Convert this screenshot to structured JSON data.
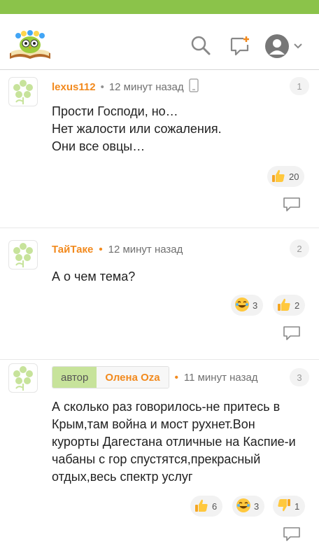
{
  "app": {
    "accent_color": "#8bc34a",
    "orange_color": "#f28a1e"
  },
  "header": {
    "logo_icon": "owl-book-logo-icon",
    "search_icon": "search-icon",
    "new_post_icon": "new-post-icon",
    "profile_icon": "user-avatar-icon"
  },
  "comments": [
    {
      "username": "lexus112",
      "time": "12 минут назад",
      "device_icon": "phone-icon",
      "number": "1",
      "lines": [
        "Прости Господи, но…",
        "Нет жалости или сожаления.",
        "Они все овцы…"
      ],
      "reactions": [
        {
          "icon": "thumbs-up-icon",
          "count": "20"
        }
      ]
    },
    {
      "username": "ТайТаке",
      "time": "12 минут назад",
      "number": "2",
      "lines": [
        "А о чем тема?"
      ],
      "reactions": [
        {
          "icon": "laugh-icon",
          "count": "3"
        },
        {
          "icon": "thumbs-up-icon",
          "count": "2"
        }
      ]
    },
    {
      "author_label": "автор",
      "username": "Олена Oza",
      "time": "11 минут назад",
      "number": "3",
      "lines": [
        "А сколько раз говорилось-не притесь в",
        "Крым,там война и мост рухнет.Вон",
        "курорты Дагестана отличные на Каспие-и",
        "чабаны с гор спустятся,прекрасный",
        "отдых,весь спектр услуг"
      ],
      "reactions": [
        {
          "icon": "thumbs-up-icon",
          "count": "6"
        },
        {
          "icon": "laugh-icon",
          "count": "3"
        },
        {
          "icon": "thumbs-down-icon",
          "count": "1"
        }
      ]
    }
  ]
}
